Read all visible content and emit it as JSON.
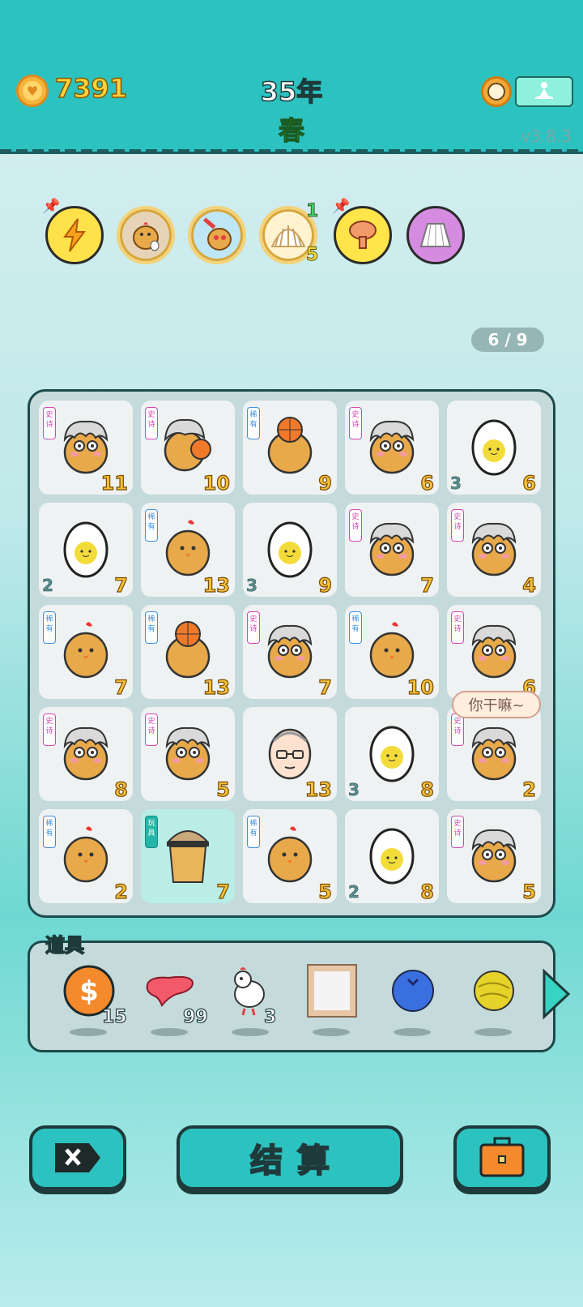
{
  "header": {
    "coins": "7391",
    "year": "35年",
    "season": "春",
    "version": "v3.8.3"
  },
  "status_icons": [
    {
      "name": "lightning",
      "bg": "#ffe24a",
      "nums": []
    },
    {
      "name": "chick-egg",
      "bg": "#e7d4b8",
      "nums": []
    },
    {
      "name": "chick-syringe",
      "bg": "#bfe6f5",
      "nums": []
    },
    {
      "name": "shell",
      "bg": "#fff3d0",
      "nums": [
        "1",
        "5"
      ]
    },
    {
      "name": "mushroom-cloud",
      "bg": "#ffe54a",
      "nums": []
    },
    {
      "name": "skirt",
      "bg": "#d58ce0",
      "nums": []
    }
  ],
  "pager": "6 / 9",
  "tags": {
    "epic": "史诗",
    "rare": "稀有",
    "fun": "玩具"
  },
  "board": [
    {
      "sprite": "chick-grandpa",
      "tag": "epic",
      "num": "11",
      "sub": ""
    },
    {
      "sprite": "chick-grandpa-ball",
      "tag": "epic",
      "num": "10",
      "sub": ""
    },
    {
      "sprite": "chick-ball",
      "tag": "rare",
      "num": "9",
      "sub": ""
    },
    {
      "sprite": "chick-grandpa",
      "tag": "epic",
      "num": "6",
      "sub": ""
    },
    {
      "sprite": "egg",
      "tag": "",
      "num": "6",
      "sub": "3"
    },
    {
      "sprite": "egg",
      "tag": "",
      "num": "7",
      "sub": "2"
    },
    {
      "sprite": "chick",
      "tag": "rare",
      "num": "13",
      "sub": ""
    },
    {
      "sprite": "egg",
      "tag": "",
      "num": "9",
      "sub": "3"
    },
    {
      "sprite": "chick-grandpa",
      "tag": "epic",
      "num": "7",
      "sub": ""
    },
    {
      "sprite": "chick-grandpa",
      "tag": "epic",
      "num": "4",
      "sub": ""
    },
    {
      "sprite": "chick",
      "tag": "rare",
      "num": "7",
      "sub": ""
    },
    {
      "sprite": "chick-ball",
      "tag": "rare",
      "num": "13",
      "sub": ""
    },
    {
      "sprite": "chick-grandpa",
      "tag": "epic",
      "num": "7",
      "sub": ""
    },
    {
      "sprite": "chick",
      "tag": "rare",
      "num": "10",
      "sub": ""
    },
    {
      "sprite": "chick-grandpa",
      "tag": "epic",
      "num": "6",
      "sub": ""
    },
    {
      "sprite": "chick-grandpa",
      "tag": "epic",
      "num": "8",
      "sub": ""
    },
    {
      "sprite": "chick-grandpa",
      "tag": "epic",
      "num": "5",
      "sub": ""
    },
    {
      "sprite": "old-man",
      "tag": "",
      "num": "13",
      "sub": ""
    },
    {
      "sprite": "egg",
      "tag": "",
      "num": "8",
      "sub": "3"
    },
    {
      "sprite": "chick-grandpa",
      "tag": "epic",
      "num": "2",
      "sub": ""
    },
    {
      "sprite": "chick",
      "tag": "rare",
      "num": "2",
      "sub": ""
    },
    {
      "sprite": "bubble-tea",
      "tag": "fun",
      "num": "7",
      "sub": "",
      "highlight": true
    },
    {
      "sprite": "chick",
      "tag": "rare",
      "num": "5",
      "sub": ""
    },
    {
      "sprite": "egg",
      "tag": "",
      "num": "8",
      "sub": "2"
    },
    {
      "sprite": "chick-grandpa",
      "tag": "epic",
      "num": "5",
      "sub": ""
    }
  ],
  "speech": "你干嘛~",
  "items_title": "道具",
  "items": [
    {
      "name": "dollar-coin",
      "count": "15"
    },
    {
      "name": "liver",
      "count": "99"
    },
    {
      "name": "white-bird",
      "count": "3"
    },
    {
      "name": "picture-frame",
      "count": ""
    },
    {
      "name": "blueberry",
      "count": ""
    },
    {
      "name": "yellow-ball",
      "count": ""
    }
  ],
  "buttons": {
    "settle": "结算"
  }
}
